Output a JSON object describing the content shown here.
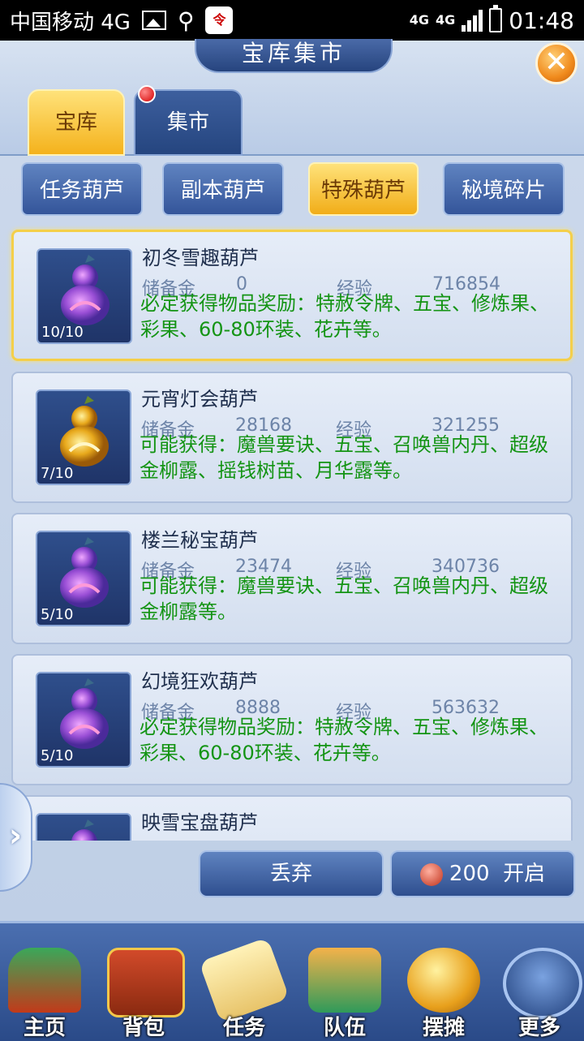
{
  "status": {
    "carrier": "中国移动 4G",
    "network": "4G",
    "network2": "4G",
    "time": "01:48",
    "app_icon_text": "令"
  },
  "window": {
    "title": "宝库集市",
    "close_icon": "close-icon"
  },
  "tabs": [
    {
      "label": "宝库",
      "active": true
    },
    {
      "label": "集市",
      "active": false,
      "has_notification": true
    }
  ],
  "subtabs": [
    {
      "label": "任务葫芦"
    },
    {
      "label": "副本葫芦"
    },
    {
      "label": "特殊葫芦",
      "active": true
    },
    {
      "label": "秘境碎片"
    }
  ],
  "stat_labels": {
    "reserve": "储备金",
    "exp": "经验"
  },
  "items": [
    {
      "name": "初冬雪趣葫芦",
      "count": "10/10",
      "reserve": "0",
      "exp": "716854",
      "reward": "必定获得物品奖励：特赦令牌、五宝、修炼果、彩果、60-80环装、花卉等。",
      "color": "purple",
      "selected": true
    },
    {
      "name": "元宵灯会葫芦",
      "count": "7/10",
      "reserve": "28168",
      "exp": "321255",
      "reward": "可能获得：魔兽要诀、五宝、召唤兽内丹、超级金柳露、摇钱树苗、月华露等。",
      "color": "gold"
    },
    {
      "name": "楼兰秘宝葫芦",
      "count": "5/10",
      "reserve": "23474",
      "exp": "340736",
      "reward": "可能获得：魔兽要诀、五宝、召唤兽内丹、超级金柳露等。",
      "color": "purple"
    },
    {
      "name": "幻境狂欢葫芦",
      "count": "5/10",
      "reserve": "8888",
      "exp": "563632",
      "reward": "必定获得物品奖励：特赦令牌、五宝、修炼果、彩果、60-80环装、花卉等。",
      "color": "purple"
    },
    {
      "name": "映雪宝盘葫芦",
      "color": "purple"
    }
  ],
  "actions": {
    "discard": "丢弃",
    "open_cost": "200",
    "open_label": "开启"
  },
  "nav": [
    {
      "label": "主页",
      "icon": "home-icon"
    },
    {
      "label": "背包",
      "icon": "chest-icon"
    },
    {
      "label": "任务",
      "icon": "scroll-icon"
    },
    {
      "label": "队伍",
      "icon": "team-icon"
    },
    {
      "label": "摆摊",
      "icon": "coin-icon"
    },
    {
      "label": "更多",
      "icon": "more-icon"
    }
  ]
}
